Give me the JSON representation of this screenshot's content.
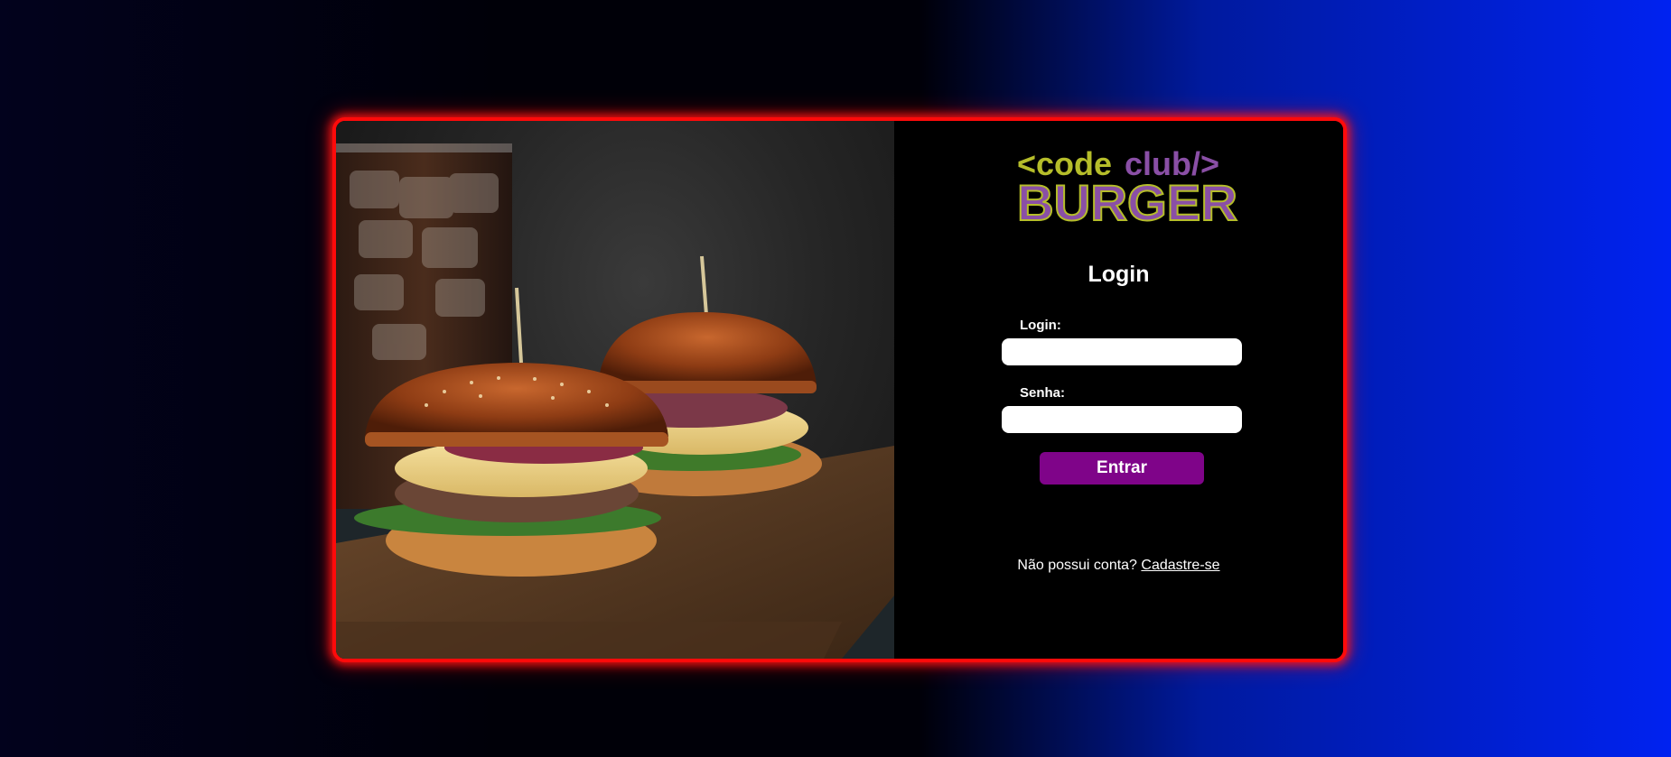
{
  "logo": {
    "line1_left": "<code",
    "line1_right": "club/>",
    "line2": "BURGER",
    "colors": {
      "lime": "#b5bd2a",
      "purple": "#8a4fa6"
    }
  },
  "form": {
    "title": "Login",
    "login_label": "Login:",
    "login_value": "",
    "password_label": "Senha:",
    "password_value": "",
    "submit_label": "Entrar"
  },
  "signup": {
    "prompt": "Não possui conta?",
    "link_label": "Cadastre-se"
  },
  "hero_image": {
    "subject": "burgers-with-soda"
  },
  "colors": {
    "card_border": "#ff0a0a",
    "button": "#7f0489",
    "input_bg": "#ffffff",
    "panel_bg": "#000000"
  }
}
